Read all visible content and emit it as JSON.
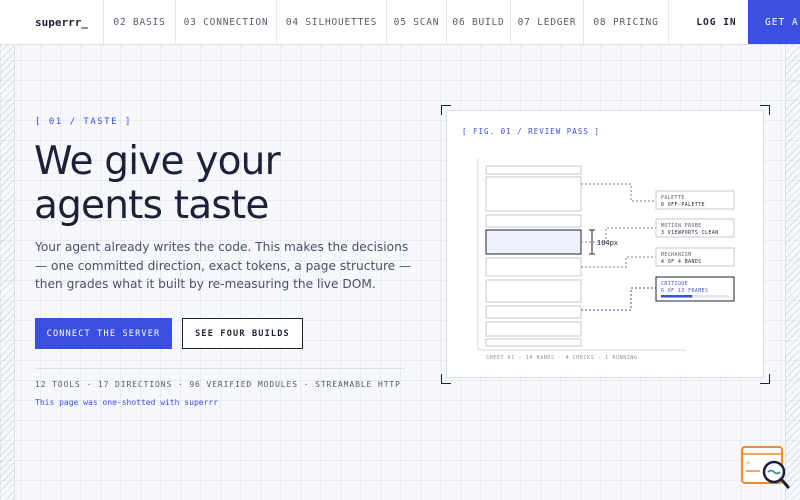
{
  "brand": {
    "logo": "superrr_"
  },
  "nav": {
    "links": [
      {
        "label": "02 BASIS",
        "width": 72
      },
      {
        "label": "03 CONNECTION",
        "width": 101
      },
      {
        "label": "04 SILHOUETTES",
        "width": 110
      },
      {
        "label": "05 SCAN",
        "width": 60
      },
      {
        "label": "06 BUILD",
        "width": 64
      },
      {
        "label": "07 LEDGER",
        "width": 73
      },
      {
        "label": "08 PRICING",
        "width": 85
      }
    ],
    "login": "LOG IN",
    "cta": "GET A"
  },
  "hero": {
    "eyebrow": "[ 01 / TASTE ]",
    "headline": "We give your agents taste",
    "lead": "Your agent already writes the code. This makes the decisions — one committed direction, exact tokens, a page structure — then grades what it built by re-measuring the live DOM.",
    "primary_button": "CONNECT THE SERVER",
    "secondary_button": "SEE FOUR BUILDS",
    "stats": "12 TOOLS · 17 DIRECTIONS · 96 VERIFIED MODULES · STREAMABLE HTTP",
    "oneshot": "This page was one-shotted with superrr"
  },
  "figure": {
    "caption": "[ FIG. 01 / REVIEW PASS ]",
    "measurement": "104px",
    "annotations": [
      {
        "title": "PALETTE",
        "detail": "0 OFF-PALETTE"
      },
      {
        "title": "MOTION PROBE",
        "detail": "3 VIEWPORTS CLEAN"
      },
      {
        "title": "MECHANISM",
        "detail": "4 OF 4 BANDS"
      },
      {
        "title": "CRITIQUE",
        "detail": "6 OF 13 FRAMES",
        "progress": 0.46
      }
    ],
    "footer": "SHEET 01 · 10 BANDS · 4 CHECKS · 1 RUNNING"
  },
  "colors": {
    "accent": "#3b4fe0",
    "ink": "#1d2138",
    "muted": "#555b70",
    "widget_orange": "#f08a2c",
    "widget_teal": "#2a8f8f"
  }
}
